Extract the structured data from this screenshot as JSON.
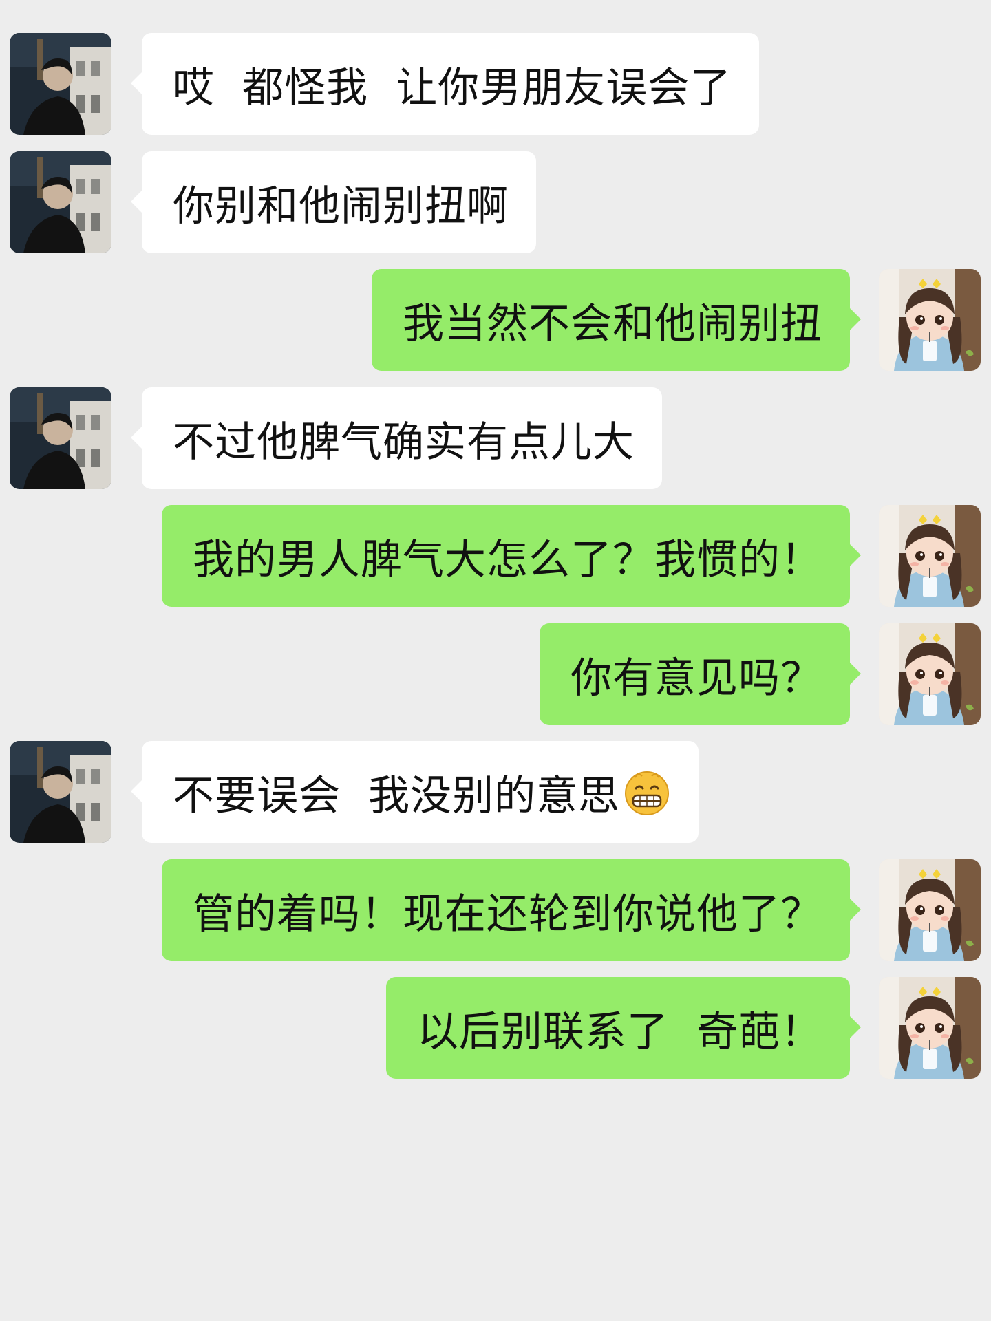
{
  "messages": [
    {
      "side": "left",
      "text": "哎  都怪我  让你男朋友误会了"
    },
    {
      "side": "left",
      "text": "你别和他闹别扭啊"
    },
    {
      "side": "right",
      "text": "我当然不会和他闹别扭"
    },
    {
      "side": "left",
      "text": "不过他脾气确实有点儿大"
    },
    {
      "side": "right",
      "text": "我的男人脾气大怎么了？我惯的！"
    },
    {
      "side": "right",
      "text": "你有意见吗？"
    },
    {
      "side": "left",
      "text": "不要误会  我没别的意思",
      "emoji": "grinning-face-icon"
    },
    {
      "side": "right",
      "text": "管的着吗！现在还轮到你说他了？"
    },
    {
      "side": "right",
      "text": "以后别联系了  奇葩！"
    }
  ],
  "colors": {
    "background": "#ededed",
    "incoming_bubble": "#ffffff",
    "outgoing_bubble": "#95ec69"
  }
}
